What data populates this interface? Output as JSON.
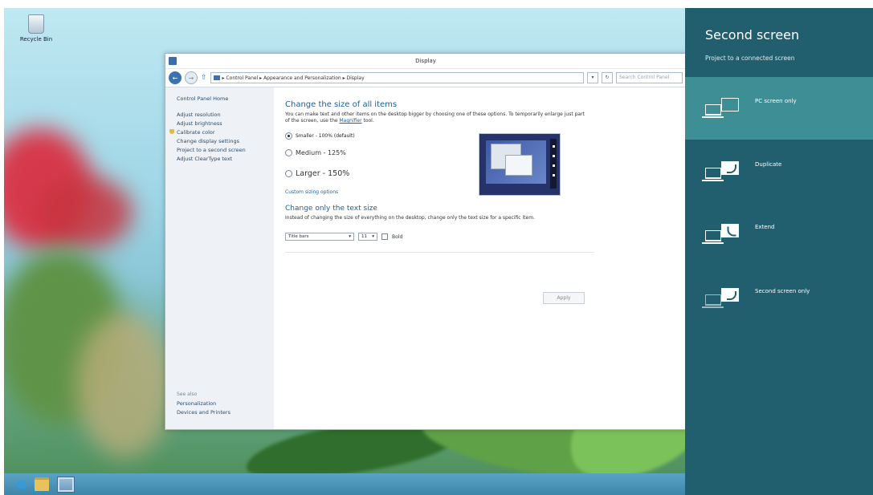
{
  "desktop": {
    "recycle_bin_label": "Recycle Bin"
  },
  "window": {
    "title": "Display",
    "address": "▸ Control Panel ▸ Appearance and Personalization ▸ Display",
    "search_placeholder": "Search Control Panel"
  },
  "sidebar": {
    "home": "Control Panel Home",
    "items": [
      "Adjust resolution",
      "Adjust brightness",
      "Calibrate color",
      "Change display settings",
      "Project to a second screen",
      "Adjust ClearType text"
    ],
    "see_also_heading": "See also",
    "see_also": [
      "Personalization",
      "Devices and Printers"
    ]
  },
  "main": {
    "heading": "Change the size of all items",
    "description_before": "You can make text and other items on the desktop bigger by choosing one of these options. To temporarily enlarge just part of the screen, use the ",
    "description_link": "Magnifier",
    "description_after": " tool.",
    "options": [
      {
        "label": "Smaller - 100% (default)",
        "selected": true
      },
      {
        "label": "Medium - 125%",
        "selected": false
      },
      {
        "label": "Larger - 150%",
        "selected": false
      }
    ],
    "custom_link": "Custom sizing options",
    "heading2": "Change only the text size",
    "description2": "Instead of changing the size of everything on the desktop, change only the text size for a specific item.",
    "item_select": "Title bars",
    "size_select": "11",
    "bold_label": "Bold",
    "apply_label": "Apply"
  },
  "charm": {
    "title": "Second screen",
    "subtitle": "Project to a connected screen",
    "options": [
      {
        "label": "PC screen only",
        "selected": true
      },
      {
        "label": "Duplicate",
        "selected": false
      },
      {
        "label": "Extend",
        "selected": false
      },
      {
        "label": "Second screen only",
        "selected": false
      }
    ]
  },
  "icons": {
    "taskbar": [
      "internet-explorer-icon",
      "file-explorer-icon",
      "control-panel-icon"
    ]
  },
  "colors": {
    "charm_bg": "#215e6e",
    "charm_selected": "#3e8e96",
    "link": "#1e5d96"
  }
}
